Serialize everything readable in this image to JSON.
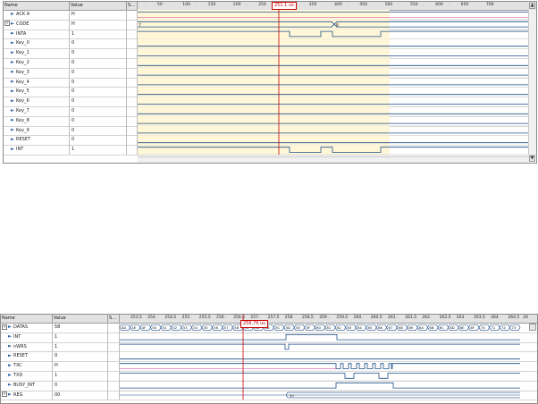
{
  "top": {
    "headers": {
      "name": "Name",
      "value": "Value",
      "sl": "S…"
    },
    "ruler_ticks": [
      "50",
      "100",
      "150",
      "200",
      "250",
      "300",
      "350",
      "400",
      "450",
      "500",
      "550",
      "600",
      "650",
      "700"
    ],
    "cursor_label": "251.1 us",
    "signals": [
      {
        "name": "ACK A",
        "value": "H",
        "icon": "signal-icon"
      },
      {
        "name": "CODE",
        "value": "H",
        "icon": "bus-icon",
        "expand": "+"
      },
      {
        "name": "INTA",
        "value": "1",
        "icon": "signal-icon"
      },
      {
        "name": "Key_0",
        "value": "0",
        "icon": "signal-icon"
      },
      {
        "name": "Key_1",
        "value": "0",
        "icon": "signal-icon"
      },
      {
        "name": "Key_2",
        "value": "0",
        "icon": "signal-icon"
      },
      {
        "name": "Key_3",
        "value": "0",
        "icon": "signal-icon"
      },
      {
        "name": "Key_4",
        "value": "0",
        "icon": "signal-icon"
      },
      {
        "name": "Key_5",
        "value": "0",
        "icon": "signal-icon"
      },
      {
        "name": "Key_6",
        "value": "0",
        "icon": "signal-icon"
      },
      {
        "name": "Key_7",
        "value": "0",
        "icon": "signal-icon"
      },
      {
        "name": "Key_8",
        "value": "0",
        "icon": "signal-icon"
      },
      {
        "name": "Key_9",
        "value": "0",
        "icon": "signal-icon"
      },
      {
        "name": "RESET",
        "value": "0",
        "icon": "signal-icon"
      },
      {
        "name": "INT",
        "value": "1",
        "icon": "signal-icon"
      }
    ],
    "code_bus_labels": [
      "7",
      "8"
    ]
  },
  "bottom": {
    "headers": {
      "name": "Name",
      "value": "Value",
      "sl": "S…"
    },
    "ruler_ticks": [
      "253.5",
      "254",
      "254.5",
      "255",
      "255.5",
      "256",
      "256.5",
      "257",
      "257.5",
      "258",
      "258.5",
      "259",
      "259.5",
      "260",
      "260.5",
      "261",
      "261.5",
      "262",
      "262.5",
      "263",
      "263.5",
      "264",
      "264.5"
    ],
    "ruler_end": "26",
    "cursor_label": "256.76 us",
    "signals": [
      {
        "name": "DATAS",
        "value": "58",
        "icon": "bus-icon",
        "expand": "+"
      },
      {
        "name": "INT",
        "value": "1",
        "icon": "signal-icon"
      },
      {
        "name": "nWRS",
        "value": "1",
        "icon": "signal-icon"
      },
      {
        "name": "RESET",
        "value": "0",
        "icon": "signal-icon"
      },
      {
        "name": "TXC",
        "value": "H",
        "icon": "signal-icon"
      },
      {
        "name": "TXD",
        "value": "1",
        "icon": "signal-icon"
      },
      {
        "name": "BUSY_INT",
        "value": "0",
        "icon": "signal-icon"
      },
      {
        "name": "REG",
        "value": "00",
        "icon": "bus-icon",
        "expand": "+"
      }
    ],
    "datas_bus": [
      "4D",
      "4E",
      "4F",
      "50",
      "51",
      "52",
      "53",
      "54",
      "55",
      "56",
      "57",
      "58",
      "59",
      "5A",
      "5B",
      "5C",
      "5D",
      "5E",
      "5F",
      "60",
      "61",
      "62",
      "63",
      "64",
      "65",
      "66",
      "67",
      "68",
      "69",
      "6A",
      "6B",
      "6C",
      "6D",
      "6E",
      "6F",
      "70",
      "71",
      "72",
      "73"
    ],
    "reg_bus_label": "50"
  },
  "colors": {
    "accent": "#3a6ea5",
    "cursor": "#cc0000",
    "highlight": "#fff7d8",
    "wave": "#1f4f8a"
  }
}
